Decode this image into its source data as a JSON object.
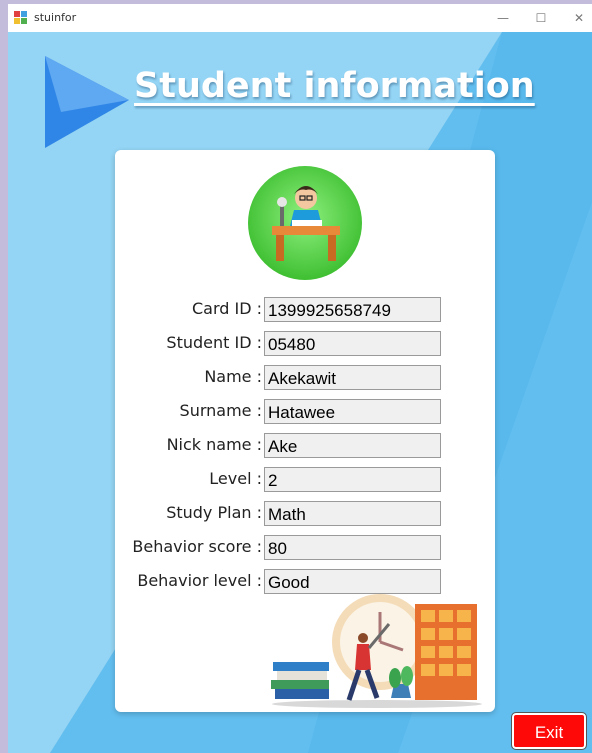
{
  "window": {
    "title": "stuinfor",
    "minimize": "—",
    "maximize": "☐",
    "close": "✕"
  },
  "header": {
    "title": "Student information"
  },
  "fields": [
    {
      "label": "Card ID :",
      "value": "1399925658749"
    },
    {
      "label": "Student ID :",
      "value": "05480"
    },
    {
      "label": "Name :",
      "value": "Akekawit"
    },
    {
      "label": "Surname :",
      "value": "Hatawee"
    },
    {
      "label": "Nick name :",
      "value": "Ake"
    },
    {
      "label": "Level :",
      "value": "2"
    },
    {
      "label": "Study Plan :",
      "value": "Math"
    },
    {
      "label": "Behavior score :",
      "value": "80"
    },
    {
      "label": "Behavior level :",
      "value": "Good"
    }
  ],
  "buttons": {
    "exit": "Exit"
  },
  "colors": {
    "background": "#62beef",
    "exit": "#ff0808",
    "avatar_circle": "#57d149"
  }
}
